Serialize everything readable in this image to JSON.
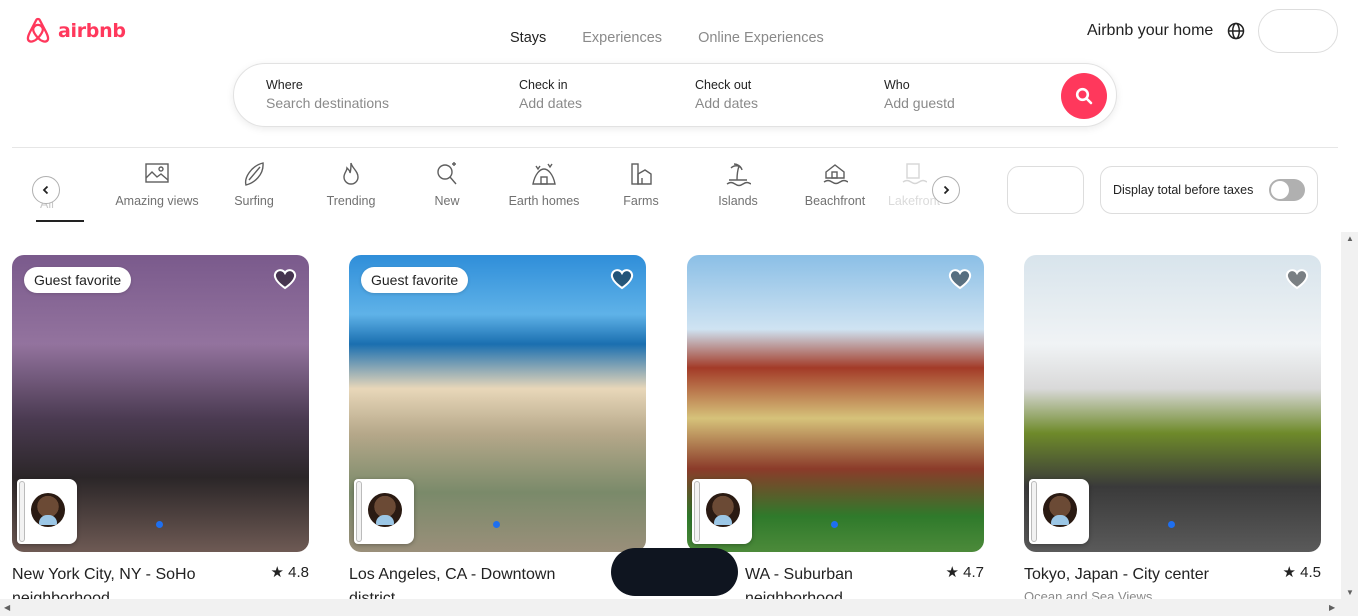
{
  "brand": {
    "name": "airbnb",
    "color": "#ff385c"
  },
  "nav": {
    "tabs": [
      "Stays",
      "Experiences",
      "Online Experiences"
    ]
  },
  "header": {
    "host_link": "Airbnb your home"
  },
  "search": {
    "where_label": "Where",
    "where_placeholder": "Search destinations",
    "checkin_label": "Check in",
    "checkin_placeholder": "Add dates",
    "checkout_label": "Check out",
    "checkout_placeholder": "Add dates",
    "who_label": "Who",
    "who_placeholder": "Add guestd"
  },
  "categories": {
    "all": "All",
    "items": [
      "Amazing views",
      "Surfing",
      "Trending",
      "New",
      "Earth homes",
      "Farms",
      "Islands",
      "Beachfront",
      "Lakefront"
    ]
  },
  "tax_toggle": {
    "label": "Display total before taxes",
    "on": false
  },
  "listings": [
    {
      "badge": "Guest favorite",
      "title": "New York City, NY - SoHo neighborhood",
      "rating": "★ 4.8",
      "subtitle": ""
    },
    {
      "badge": "Guest favorite",
      "title": "Los Angeles, CA - Downtown district",
      "rating": "★",
      "subtitle": ""
    },
    {
      "badge": "",
      "title": "WA - Suburban neighborhood",
      "rating": "★ 4.7",
      "subtitle": ""
    },
    {
      "badge": "",
      "title": "Tokyo, Japan - City center",
      "rating": "★ 4.5",
      "subtitle": "Ocean and Sea Views"
    }
  ]
}
